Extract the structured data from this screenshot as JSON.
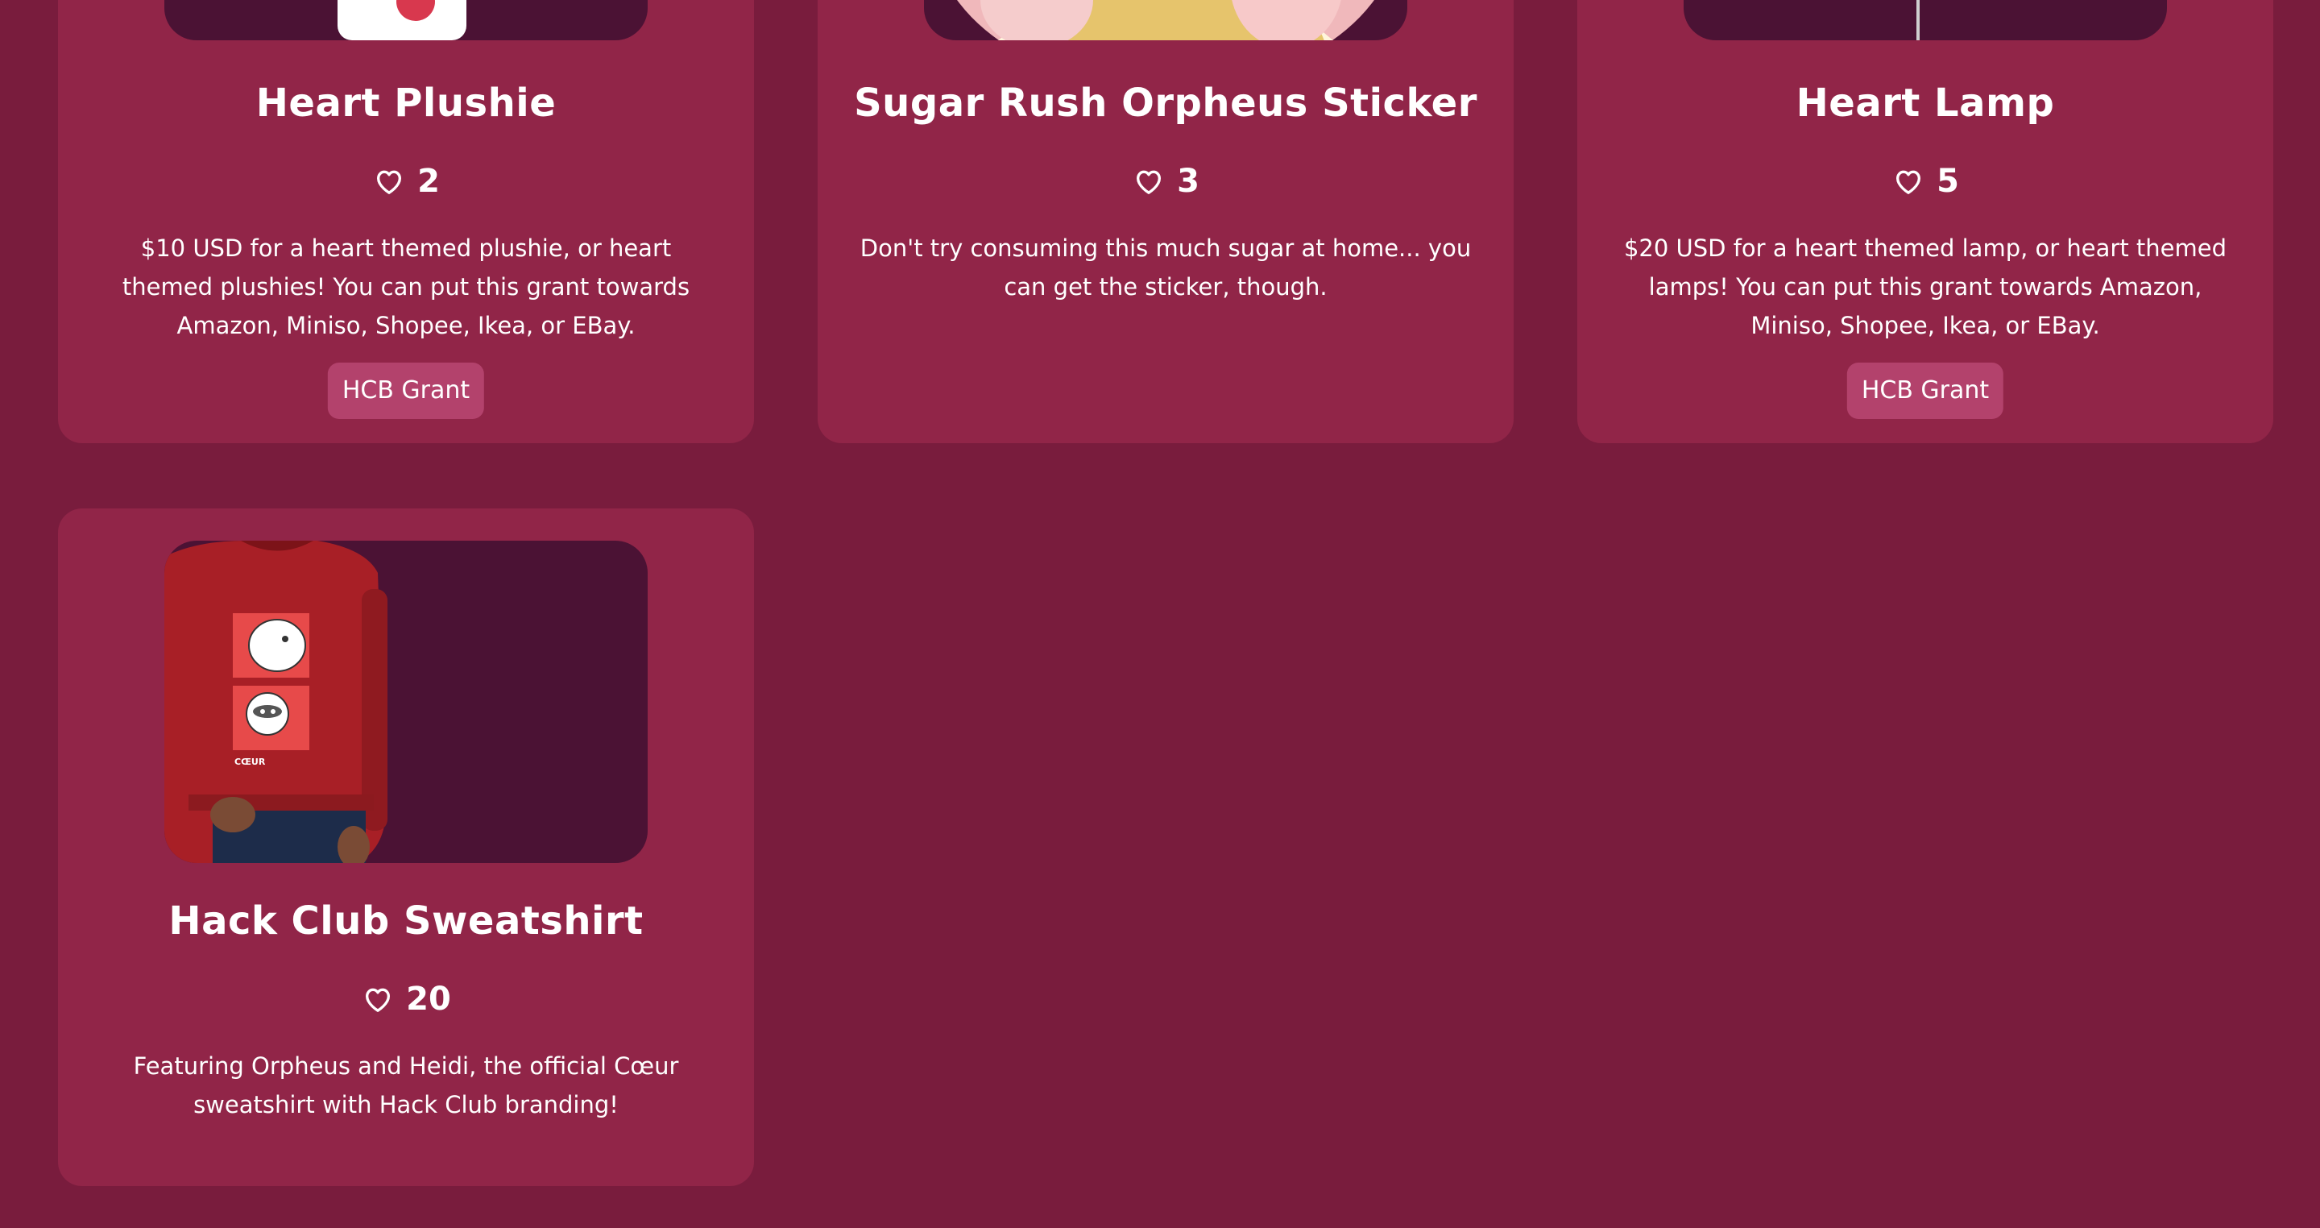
{
  "colors": {
    "page_background": "#791c3d",
    "card_background": "#912548",
    "image_frame": "#4b1234",
    "tag_background": "#b3426c",
    "text": "#ffffff"
  },
  "items": [
    {
      "title": "Heart Plushie",
      "likes": "2",
      "description": "$10 USD for a heart themed plushie, or heart themed plushies! You can put this grant towards Amazon, Miniso, Shopee, Ikea, or EBay.",
      "tag": "HCB Grant",
      "icon": "heart-outline-icon"
    },
    {
      "title": "Sugar Rush Orpheus Sticker",
      "likes": "3",
      "description": "Don't try consuming this much sugar at home... you can get the sticker, though.",
      "icon": "heart-outline-icon"
    },
    {
      "title": "Heart Lamp",
      "likes": "5",
      "description": "$20 USD for a heart themed lamp, or heart themed lamps! You can put this grant towards Amazon, Miniso, Shopee, Ikea, or EBay.",
      "tag": "HCB Grant",
      "icon": "heart-outline-icon"
    },
    {
      "title": "Hack Club Sweatshirt",
      "likes": "20",
      "description": "Featuring Orpheus and Heidi, the official Cœur sweatshirt with Hack Club branding!",
      "icon": "heart-outline-icon",
      "image_text": "CŒUR"
    }
  ]
}
